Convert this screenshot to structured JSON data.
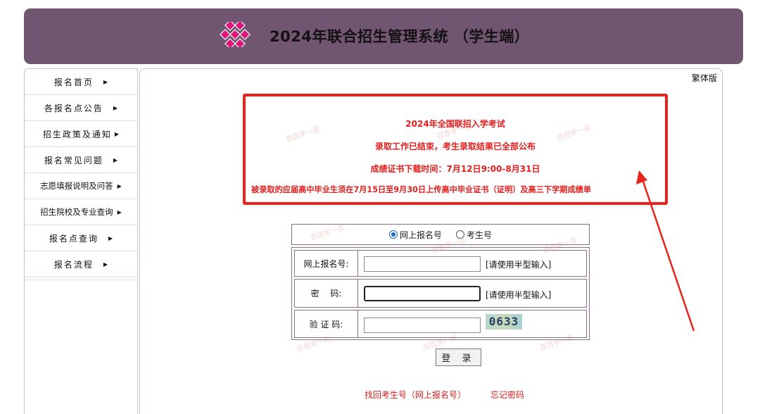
{
  "header": {
    "title": "2024年联合招生管理系统 （学生端）"
  },
  "sidebar": {
    "items": [
      {
        "label": "报名首页"
      },
      {
        "label": "各报名点公告"
      },
      {
        "label": "招生政策及通知"
      },
      {
        "label": "报名常见问题"
      },
      {
        "label": "志愿填报说明及问答"
      },
      {
        "label": "招生院校及专业查询"
      },
      {
        "label": "报名点查询"
      },
      {
        "label": "报名流程"
      }
    ]
  },
  "main": {
    "traditional_link": "繁体版"
  },
  "notice": {
    "line1": "2024年全国联招入学考试",
    "line2": "录取工作已结束，考生录取结果已全部公布",
    "line3": "成绩证书下载时间：7月12日9:00-8月31日",
    "line4": "被录取的应届高中毕业生须在7月15日至9月30日上传高中毕业证书（证明）及高三下学期成绩单"
  },
  "login": {
    "radio_online": "网上报名号",
    "radio_exam": "考生号",
    "online_label": "网上报名号:",
    "password_label": "密　  码:",
    "captcha_label": "验 证 码:",
    "hint": "[请使用半型输入]",
    "captcha_text": "0633",
    "submit": "登 录",
    "recover_link": "找回考生号（网上报名号）",
    "forgot_link": "忘记密码"
  },
  "colors": {
    "header": "#715672",
    "accent_red": "#e8231b"
  }
}
